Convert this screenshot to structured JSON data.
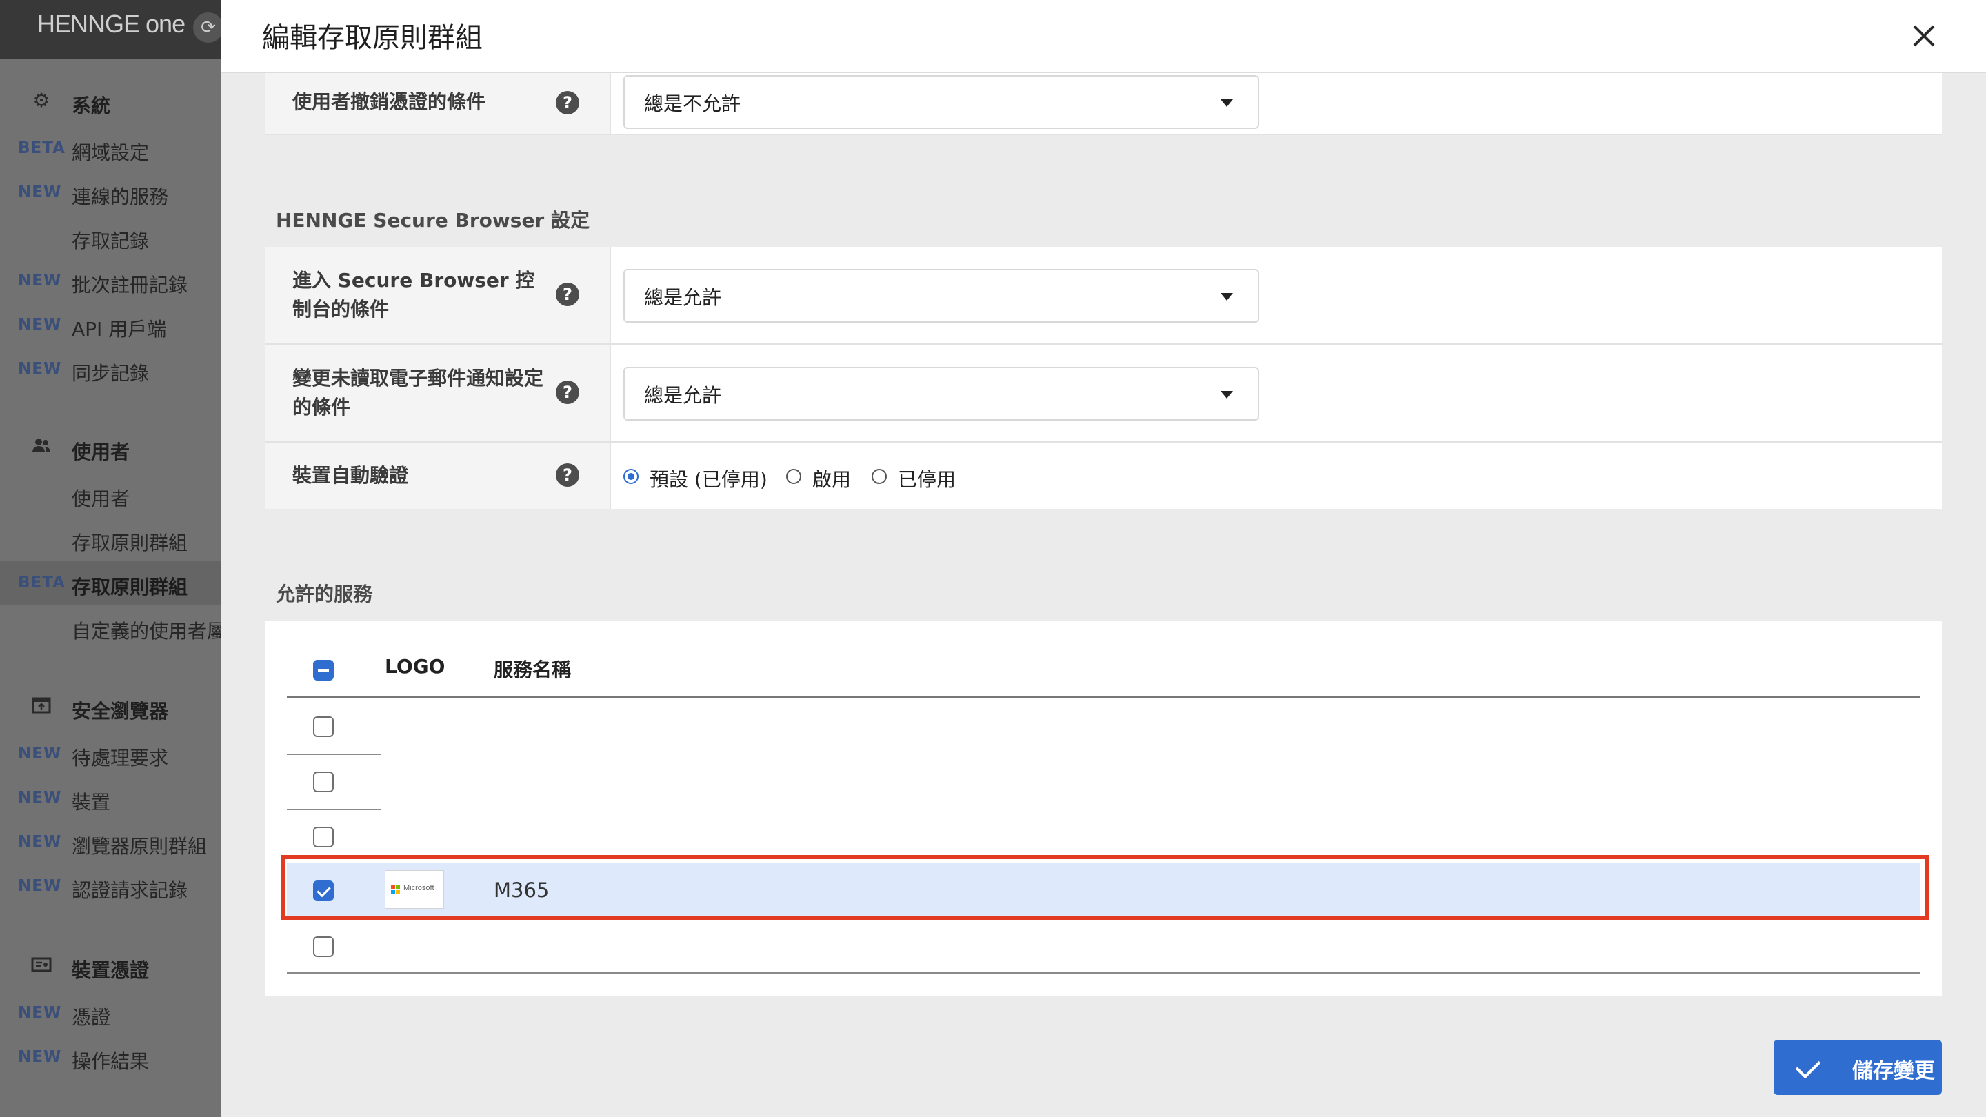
{
  "brand": {
    "logo_text": "HENNGE one"
  },
  "sidebar": {
    "sections": [
      {
        "icon": "gear-icon",
        "label": "系統",
        "items": [
          {
            "badge": "BETA",
            "label": "網域設定"
          },
          {
            "badge": "NEW",
            "label": "連線的服務"
          },
          {
            "badge": "",
            "label": "存取記錄"
          },
          {
            "badge": "NEW",
            "label": "批次註冊記錄"
          },
          {
            "badge": "NEW",
            "label": "API 用戶端"
          },
          {
            "badge": "NEW",
            "label": "同步記錄"
          }
        ]
      },
      {
        "icon": "users-icon",
        "label": "使用者",
        "items": [
          {
            "badge": "",
            "label": "使用者"
          },
          {
            "badge": "",
            "label": "存取原則群組"
          },
          {
            "badge": "BETA",
            "label": "存取原則群組",
            "active": true
          },
          {
            "badge": "",
            "label": "自定義的使用者屬"
          }
        ]
      },
      {
        "icon": "browser-icon",
        "label": "安全瀏覽器",
        "items": [
          {
            "badge": "NEW",
            "label": "待處理要求"
          },
          {
            "badge": "NEW",
            "label": "裝置"
          },
          {
            "badge": "NEW",
            "label": "瀏覽器原則群組"
          },
          {
            "badge": "NEW",
            "label": "認證請求記錄"
          }
        ]
      },
      {
        "icon": "certificate-icon",
        "label": "裝置憑證",
        "items": [
          {
            "badge": "NEW",
            "label": "憑證"
          },
          {
            "badge": "NEW",
            "label": "操作結果"
          }
        ]
      }
    ]
  },
  "modal": {
    "title": "編輯存取原則群組",
    "revoke_row": {
      "label": "使用者撤銷憑證的條件",
      "value": "總是不允許"
    },
    "secure_browser": {
      "section_title": "HENNGE Secure Browser 設定",
      "rows": [
        {
          "label": "進入 Secure Browser 控制台的條件",
          "value": "總是允許"
        },
        {
          "label": "變更未讀取電子郵件通知設定的條件",
          "value": "總是允許"
        }
      ],
      "auto_verify": {
        "label": "裝置自動驗證",
        "options": [
          "預設 (已停用)",
          "啟用",
          "已停用"
        ],
        "selected": "預設 (已停用)"
      }
    },
    "services": {
      "section_title": "允許的服務",
      "columns": [
        "LOGO",
        "服務名稱"
      ],
      "rows": [
        {
          "checked": false,
          "logo": "",
          "name": ""
        },
        {
          "checked": false,
          "logo": "",
          "name": ""
        },
        {
          "checked": false,
          "logo": "",
          "name": ""
        },
        {
          "checked": true,
          "logo": "Microsoft",
          "name": "M365"
        },
        {
          "checked": false,
          "logo": "",
          "name": ""
        }
      ]
    },
    "save_label": "儲存變更"
  }
}
